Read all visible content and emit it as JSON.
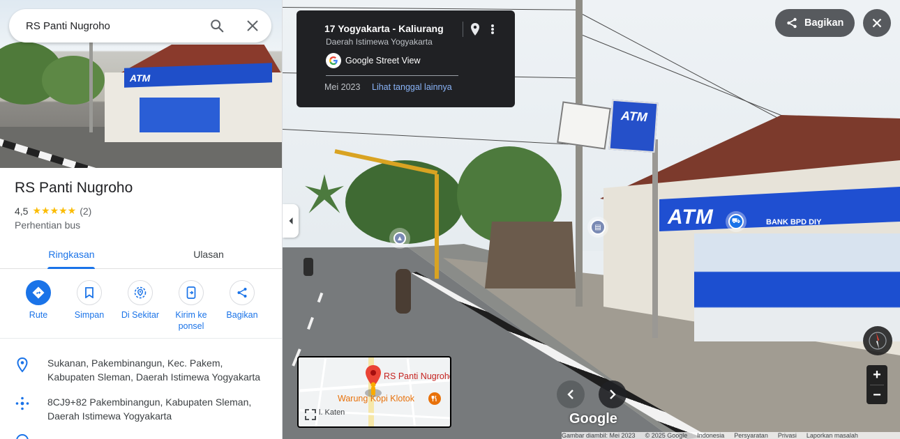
{
  "search": {
    "value": "RS Panti Nugroho",
    "search_icon": "search-icon",
    "clear_icon": "close-icon"
  },
  "place": {
    "title": "RS Panti Nugroho",
    "rating": "4,5",
    "stars": "★★★★★",
    "review_count": "(2)",
    "category": "Perhentian bus"
  },
  "tabs": {
    "overview": "Ringkasan",
    "reviews": "Ulasan"
  },
  "actions": [
    {
      "label": "Rute",
      "icon": "directions-icon"
    },
    {
      "label": "Simpan",
      "icon": "bookmark-icon"
    },
    {
      "label": "Di Sekitar",
      "icon": "nearby-icon"
    },
    {
      "label": "Kirim ke ponsel",
      "icon": "send-to-phone-icon"
    },
    {
      "label": "Bagikan",
      "icon": "share-icon"
    }
  ],
  "info": {
    "address": "Sukanan, Pakembinangun, Kec. Pakem, Kabupaten Sleman, Daerah Istimewa Yogyakarta",
    "plus_code": "8CJ9+82 Pakembinangun, Kabupaten Sleman, Daerah Istimewa Yogyakarta"
  },
  "street_view": {
    "location": "17 Yogyakarta - Kaliurang",
    "region": "Daerah Istimewa Yogyakarta",
    "brand": "Google Street View",
    "date": "Mei 2023",
    "other_dates": "Lihat tanggal lainnya",
    "share_label": "Bagikan",
    "wordmark": "Google",
    "sign_atm": "ATM",
    "band_atm": "ATM",
    "bank_name": "BANK BPD DIY"
  },
  "minimap": {
    "place": "RS Panti Nugroho",
    "poi": "Warung Kopi Klotok",
    "street": "l. Katen"
  },
  "footer": {
    "captured": "Gambar diambil: Mei 2023",
    "copyright": "© 2025 Google",
    "country": "Indonesia",
    "terms": "Persyaratan",
    "privacy": "Privasi",
    "report": "Laporkan masalah"
  },
  "colors": {
    "accent": "#1a73e8",
    "star": "#fbbc04",
    "card_bg": "#202124",
    "link_dark": "#8ab4f8",
    "pin_red": "#ea4335",
    "atm_blue": "#1f4fd1"
  }
}
